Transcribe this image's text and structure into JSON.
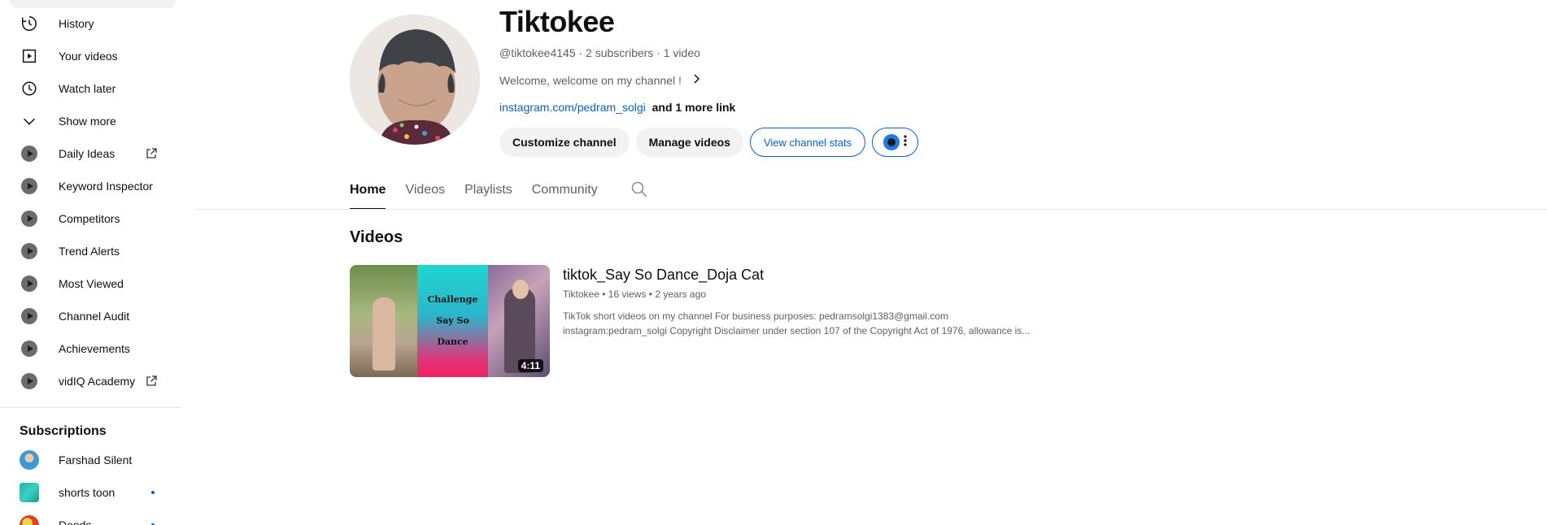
{
  "sidebar": {
    "items": [
      {
        "label": "History",
        "icon": "history-icon"
      },
      {
        "label": "Your videos",
        "icon": "your-videos-icon"
      },
      {
        "label": "Watch later",
        "icon": "watch-later-icon"
      },
      {
        "label": "Show more",
        "icon": "chevron-down-icon"
      },
      {
        "label": "Daily Ideas",
        "icon": "vidiq-icon",
        "external": true
      },
      {
        "label": "Keyword Inspector",
        "icon": "vidiq-icon"
      },
      {
        "label": "Competitors",
        "icon": "vidiq-icon"
      },
      {
        "label": "Trend Alerts",
        "icon": "vidiq-icon"
      },
      {
        "label": "Most Viewed",
        "icon": "vidiq-icon"
      },
      {
        "label": "Channel Audit",
        "icon": "vidiq-icon"
      },
      {
        "label": "Achievements",
        "icon": "vidiq-icon"
      },
      {
        "label": "vidIQ Academy",
        "icon": "vidiq-icon",
        "external": true
      }
    ],
    "subscriptions_heading": "Subscriptions",
    "subscriptions": [
      {
        "name": "Farshad Silent",
        "new_content": false
      },
      {
        "name": "shorts toon",
        "new_content": true
      },
      {
        "name": "Deeds",
        "new_content": true
      }
    ]
  },
  "channel": {
    "name": "Tiktokee",
    "handle": "@tiktokee4145",
    "subscribers": "2 subscribers",
    "videos_count": "1 video",
    "meta_line": "@tiktokee4145 · 2 subscribers · 1 video",
    "description": "Welcome, welcome on my channel !",
    "link_text": "instagram.com/pedram_solgi",
    "more_links": "and 1 more link"
  },
  "actions": {
    "customize": "Customize channel",
    "manage": "Manage videos",
    "stats": "View channel stats"
  },
  "tabs": [
    {
      "label": "Home",
      "active": true
    },
    {
      "label": "Videos",
      "active": false
    },
    {
      "label": "Playlists",
      "active": false
    },
    {
      "label": "Community",
      "active": false
    }
  ],
  "videos_section": {
    "title": "Videos",
    "video": {
      "title": "tiktok_Say So Dance_Doja Cat",
      "channel": "Tiktokee",
      "views": "16 views",
      "age": "2 years ago",
      "meta_line": "Tiktokee • 16 views • 2 years ago",
      "description_line1": "TikTok short videos on my channel For business purposes: pedramsolgi1383@gmail.com",
      "description_line2": "instagram:pedram_solgi Copyright Disclaimer under section 107 of the Copyright Act of 1976, allowance is...",
      "duration": "4:11",
      "thumbnail_text": [
        "Challenge",
        "Say So",
        "Dance"
      ]
    }
  },
  "colors": {
    "link_blue": "#065fd4",
    "text_primary": "#0f0f0f",
    "text_secondary": "#606060",
    "chip_bg": "#f2f2f2"
  }
}
